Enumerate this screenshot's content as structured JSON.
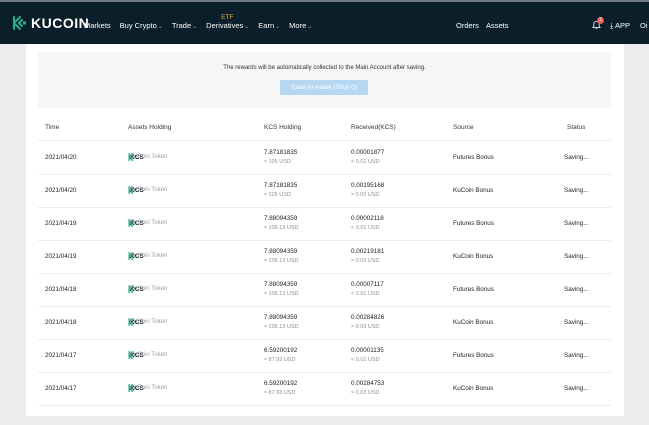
{
  "brand": {
    "name": "KUCOIN",
    "accent": "#23af91"
  },
  "nav": {
    "markets": "Markets",
    "buy_crypto": "Buy Crypto",
    "trade": "Trade",
    "derivatives": "Derivatives",
    "etf_badge": "ETF",
    "earn": "Earn",
    "more": "More",
    "orders": "Orders",
    "assets": "Assets",
    "notification_count": "2",
    "app": "APP",
    "user_partial": "Oi"
  },
  "notice": {
    "text": "The rewards will be automatically collected to the Main Account after saving.",
    "button": "Save to wallet (Total 0)"
  },
  "table": {
    "headers": [
      "Time",
      "Assets Holding",
      "KCS Holding",
      "Received(KCS)",
      "Source",
      "Status"
    ],
    "rows": [
      {
        "time": "2021/04/20",
        "symbol": "KCS",
        "token": "KuCoin Token",
        "holding": "7.87181835",
        "holding_usd": "≈ 105 USD",
        "received": "0.00001877",
        "received_usd": "< 0.01 USD",
        "source": "Futures Bonus",
        "status": "Saving..."
      },
      {
        "time": "2021/04/20",
        "symbol": "KCS",
        "token": "KuCoin Token",
        "holding": "7.87181835",
        "holding_usd": "≈ 105 USD",
        "received": "0.00195168",
        "received_usd": "≈ 0.02 USD",
        "source": "KuCoin Bonus",
        "status": "Saving..."
      },
      {
        "time": "2021/04/19",
        "symbol": "KCS",
        "token": "KuCoin Token",
        "holding": "7.88094359",
        "holding_usd": "≈ 105.13 USD",
        "received": "0.00002118",
        "received_usd": "< 0.01 USD",
        "source": "Futures Bonus",
        "status": "Saving..."
      },
      {
        "time": "2021/04/19",
        "symbol": "KCS",
        "token": "KuCoin Token",
        "holding": "7.88094359",
        "holding_usd": "≈ 105.13 USD",
        "received": "0.00219181",
        "received_usd": "≈ 0.02 USD",
        "source": "KuCoin Bonus",
        "status": "Saving..."
      },
      {
        "time": "2021/04/18",
        "symbol": "KCS",
        "token": "KuCoin Token",
        "holding": "7.88094359",
        "holding_usd": "≈ 105.13 USD",
        "received": "0.00007117",
        "received_usd": "< 0.01 USD",
        "source": "Futures Bonus",
        "status": "Saving..."
      },
      {
        "time": "2021/04/18",
        "symbol": "KCS",
        "token": "KuCoin Token",
        "holding": "7.88094359",
        "holding_usd": "≈ 105.13 USD",
        "received": "0.00284826",
        "received_usd": "≈ 0.03 USD",
        "source": "KuCoin Bonus",
        "status": "Saving..."
      },
      {
        "time": "2021/04/17",
        "symbol": "KCS",
        "token": "KuCoin Token",
        "holding": "6.59200192",
        "holding_usd": "≈ 87.93 USD",
        "received": "0.00001135",
        "received_usd": "< 0.01 USD",
        "source": "Futures Bonus",
        "status": "Saving..."
      },
      {
        "time": "2021/04/17",
        "symbol": "KCS",
        "token": "KuCoin Token",
        "holding": "6.59200192",
        "holding_usd": "≈ 87.93 USD",
        "received": "0.00284753",
        "received_usd": "≈ 0.03 USD",
        "source": "KuCoin Bonus",
        "status": "Saving..."
      }
    ]
  }
}
